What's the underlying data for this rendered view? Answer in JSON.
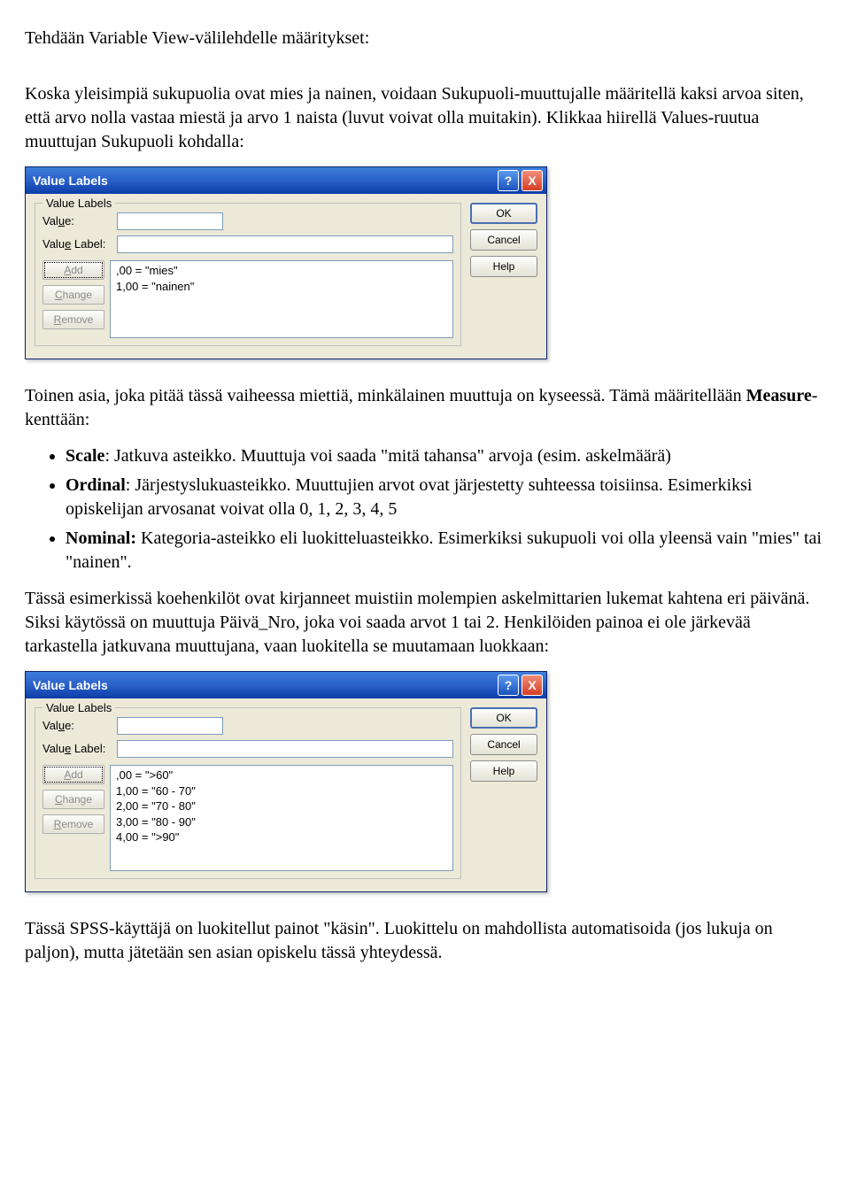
{
  "para1": "Tehdään Variable View-välilehdelle määritykset:",
  "para2": "Koska yleisimpiä sukupuolia ovat mies ja nainen, voidaan Sukupuoli-muuttujalle määritellä kaksi arvoa siten, että arvo nolla vastaa miestä ja arvo 1 naista (luvut voivat olla muitakin). Klikkaa hiirellä Values-ruutua muuttujan Sukupuoli kohdalla:",
  "para3": "Toinen asia, joka pitää tässä vaiheessa miettiä, minkälainen muuttuja on kyseessä. Tämä määritellään ",
  "para3b": "-kenttään:",
  "measure_word": "Measure",
  "bullet1a": "Scale",
  "bullet1b": ": Jatkuva asteikko. Muuttuja voi saada \"mitä tahansa\" arvoja (esim. askelmäärä)",
  "bullet2a": "Ordinal",
  "bullet2b": ": Järjestyslukuasteikko. Muuttujien arvot ovat järjestetty suhteessa toisiinsa. Esimerkiksi opiskelijan arvosanat voivat olla 0, 1, 2, 3, 4, 5",
  "bullet3a": "Nominal:",
  "bullet3b": " Kategoria-asteikko eli luokitteluasteikko. Esimerkiksi sukupuoli voi olla yleensä vain \"mies\" tai \"nainen\".",
  "para4": "Tässä esimerkissä koehenkilöt ovat kirjanneet muistiin molempien askelmittarien lukemat kahtena eri päivänä. Siksi käytössä on muuttuja Päivä_Nro, joka voi saada arvot 1 tai 2. Henkilöiden painoa ei ole järkevää tarkastella jatkuvana muuttujana, vaan luokitella se muutamaan luokkaan:",
  "para5": "Tässä SPSS-käyttäjä on luokitellut painot \"käsin\". Luokittelu on mahdollista automatisoida (jos lukuja on paljon), mutta jätetään sen asian opiskelu tässä yhteydessä.",
  "dlg": {
    "title": "Value Labels",
    "legend": "Value Labels",
    "value_label_pre": "Val",
    "value_label_u": "u",
    "value_label_post": "e:",
    "vlabel_pre": "Valu",
    "vlabel_u": "e",
    "vlabel_post": " Label:",
    "add_u": "A",
    "add_post": "dd",
    "change_u": "C",
    "change_post": "hange",
    "remove_u": "R",
    "remove_post": "emove",
    "ok": "OK",
    "cancel": "Cancel",
    "help": "Help",
    "help_icon": "?",
    "close_icon": "X"
  },
  "list1": ",00 = \"mies\"\n1,00 = \"nainen\"",
  "list2": ",00 = \">60\"\n1,00 = \"60 - 70\"\n2,00 = \"70 - 80\"\n3,00 = \"80 - 90\"\n4,00 = \">90\""
}
